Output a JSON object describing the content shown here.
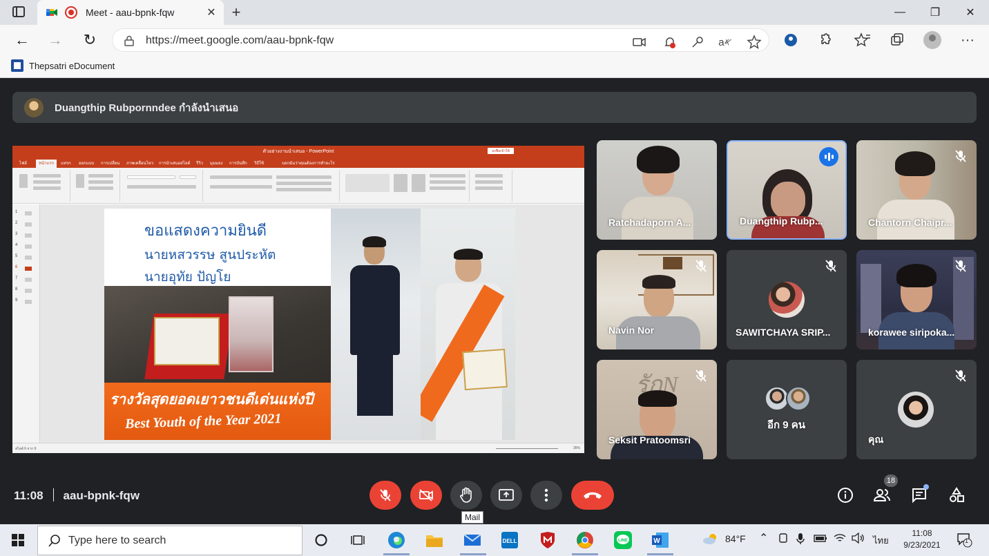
{
  "browser": {
    "tab_title": "Meet - aau-bpnk-fqw",
    "url": "https://meet.google.com/aau-bpnk-fqw",
    "bookmark": "Thepsatri eDocument"
  },
  "meet": {
    "presenting_text": "Duangthip Rubpornndee กำลังนำเสนอ",
    "meeting_time": "11:08",
    "meeting_code": "aau-bpnk-fqw",
    "participant_count": "18",
    "tooltip": "Mail"
  },
  "slide": {
    "line1": "ขอแสดงความยินดี",
    "line2": "นายหสวรรษ สูนประหัต",
    "line3": "นายอุทัย ปัญโย",
    "banner_thai": "รางวัลสุดยอดเยาวชนดีเด่นแห่งปี",
    "banner_en": "Best Youth of the Year 2021"
  },
  "powerpoint": {
    "title": "ตัวอย่างงานนำเสนอ - PowerPoint",
    "signin": "ลงชื่อเข้าใช้",
    "menu": [
      "ไฟล์",
      "หน้าแรก",
      "แทรก",
      "ออกแบบ",
      "การเปลี่ยน",
      "ภาพเคลื่อนไหว",
      "การนำเสนอสไลด์",
      "รีวิว",
      "มุมมอง",
      "การบันทึก",
      "วิธีใช้",
      "บอกฉันว่าคุณต้องการทำอะไร"
    ],
    "thumbs": [
      "1",
      "2",
      "3",
      "4",
      "5",
      "6",
      "7",
      "8",
      "9"
    ],
    "status_left": "สไลด์ 6 จาก 9",
    "status_zoom": "35%"
  },
  "participants": [
    {
      "name": "Ratchadaporn A...",
      "muted": false
    },
    {
      "name": "Duangthip Rubp...",
      "muted": false,
      "speaking": true
    },
    {
      "name": "Chantorn Chaipr...",
      "muted": true
    },
    {
      "name": "Navin Nor",
      "muted": true
    },
    {
      "name": "SAWITCHAYA SRIP...",
      "muted": true
    },
    {
      "name": "korawee siripoka...",
      "muted": true
    },
    {
      "name": "Seksit Pratoomsri",
      "muted": true
    },
    {
      "name": "อีก 9 คน",
      "muted": false
    },
    {
      "name": "คุณ",
      "muted": true
    }
  ],
  "taskbar": {
    "search_placeholder": "Type here to search",
    "weather": "84°F",
    "lang": "ไทย",
    "time": "11:08",
    "date": "9/23/2021",
    "notif_count": "1"
  },
  "colors": {
    "meet_bg": "#202124",
    "tile_bg": "#3c4043",
    "end_call": "#ea4335",
    "active_border": "#8ab4f8",
    "ppt_red": "#c43e1c"
  }
}
